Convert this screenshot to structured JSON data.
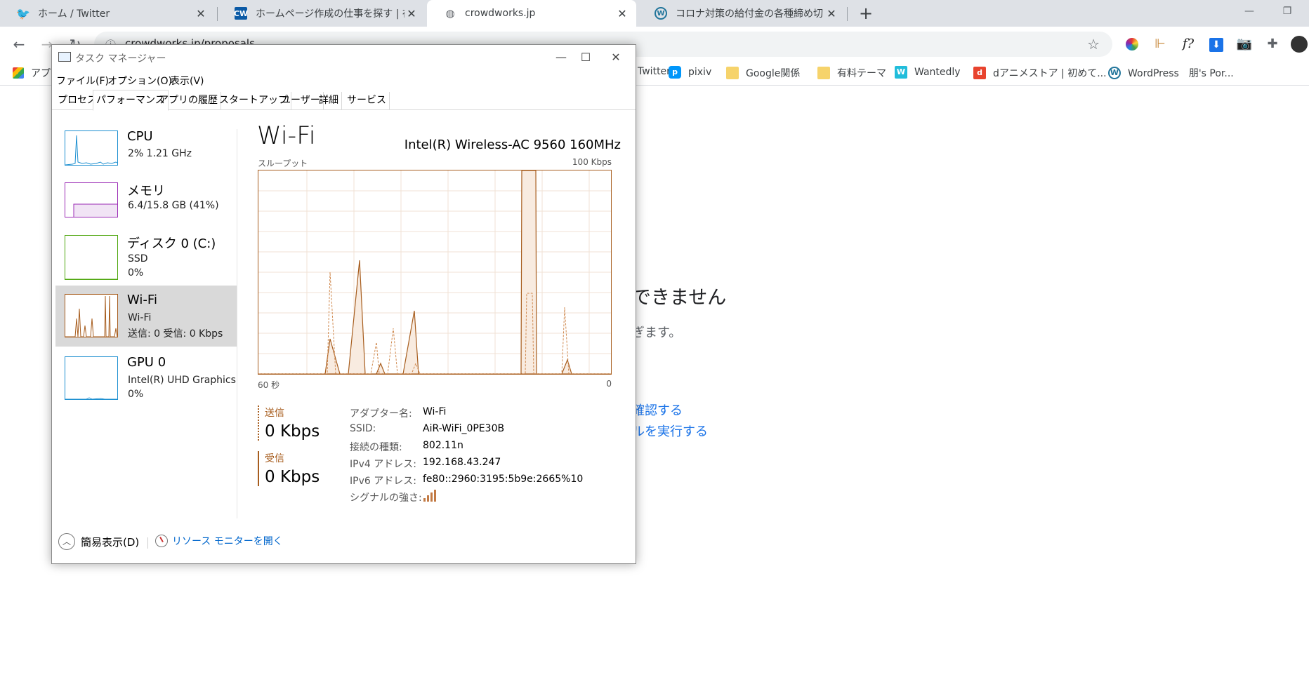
{
  "browser": {
    "tabs": [
      {
        "title": "ホーム / Twitter",
        "icon": "twitter-icon"
      },
      {
        "title": "ホームページ作成の仕事を探す | 在宅",
        "icon": "crowdworks-icon"
      },
      {
        "title": "crowdworks.jp",
        "icon": "globe-icon"
      },
      {
        "title": "コロナ対策の給付金の各種締め切り",
        "icon": "wordpress-icon"
      }
    ],
    "url": "crowdworks.jp/proposals",
    "bookmarks": [
      {
        "label": "アプリ",
        "icon": "apps-grid-icon"
      },
      {
        "label": "Twitter",
        "icon": "twitter-icon"
      },
      {
        "label": "pixiv",
        "icon": "pixiv-icon"
      },
      {
        "label": "Google関係",
        "icon": "folder-icon"
      },
      {
        "label": "有料テーマ",
        "icon": "folder-icon"
      },
      {
        "label": "Wantedly",
        "icon": "wantedly-icon"
      },
      {
        "label": "dアニメストア | 初めて...",
        "icon": "danime-icon"
      },
      {
        "label": "WordPress　朋's Por...",
        "icon": "wordpress-icon"
      }
    ],
    "page": {
      "error_heading_fragment": "できません",
      "error_sub_fragment": "ぎます。",
      "link1_fragment": "確認する",
      "link2_fragment": "ルを実行する"
    }
  },
  "task_manager": {
    "title": "タスク マネージャー",
    "menu": [
      "ファイル(F)",
      "オプション(O)",
      "表示(V)"
    ],
    "tabs": [
      "プロセス",
      "パフォーマンス",
      "アプリの履歴",
      "スタートアップ",
      "ユーザー",
      "詳細",
      "サービス"
    ],
    "active_tab": "パフォーマンス",
    "resources": [
      {
        "name": "CPU",
        "line1": "2%  1.21 GHz",
        "line2": "",
        "color": "#1c8fd0"
      },
      {
        "name": "メモリ",
        "line1": "6.4/15.8 GB (41%)",
        "line2": "",
        "color": "#9b2bb5"
      },
      {
        "name": "ディスク 0 (C:)",
        "line1": "SSD",
        "line2": "0%",
        "color": "#4da60c"
      },
      {
        "name": "Wi-Fi",
        "line1": "Wi-Fi",
        "line2": "送信: 0  受信: 0 Kbps",
        "color": "#a75d1e"
      },
      {
        "name": "GPU 0",
        "line1": "Intel(R) UHD Graphics",
        "line2": "0%",
        "color": "#1c8fd0"
      }
    ],
    "detail": {
      "title": "Wi-Fi",
      "adapter": "Intel(R) Wireless-AC 9560 160MHz",
      "graph_label": "スループット",
      "graph_max": "100 Kbps",
      "graph_left": "60 秒",
      "graph_right": "0",
      "send_label": "送信",
      "send_value": "0 Kbps",
      "recv_label": "受信",
      "recv_value": "0 Kbps",
      "props": [
        {
          "key": "アダプター名:",
          "value": "Wi-Fi"
        },
        {
          "key": "SSID:",
          "value": "AiR-WiFi_0PE30B"
        },
        {
          "key": "接続の種類:",
          "value": "802.11n"
        },
        {
          "key": "IPv4 アドレス:",
          "value": "192.168.43.247"
        },
        {
          "key": "IPv6 アドレス:",
          "value": "fe80::2960:3195:5b9e:2665%10"
        },
        {
          "key": "シグナルの強さ:",
          "value": ""
        }
      ],
      "signal_bars": 4
    },
    "fewer_details": "簡易表示(D)",
    "resource_monitor": "リソース モニターを開く"
  }
}
